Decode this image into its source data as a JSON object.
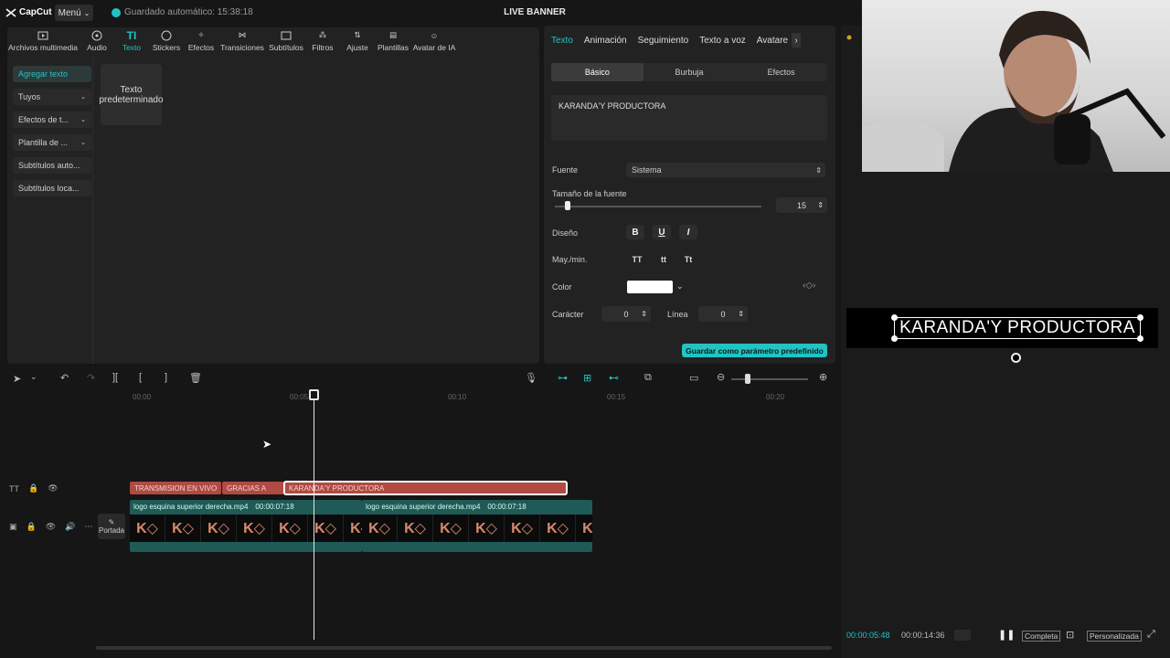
{
  "app": {
    "logo": "CapCut",
    "menu_label": "Menú",
    "autosave": "Guardado automático: 15:38:18",
    "project_title": "LIVE BANNER"
  },
  "toolbar": {
    "items": [
      {
        "label": "Archivos multimedia",
        "icon": "media-icon"
      },
      {
        "label": "Audio",
        "icon": "audio-icon"
      },
      {
        "label": "Texto",
        "icon": "text-icon"
      },
      {
        "label": "Stickers",
        "icon": "sticker-icon"
      },
      {
        "label": "Efectos",
        "icon": "effects-icon"
      },
      {
        "label": "Transiciones",
        "icon": "transitions-icon"
      },
      {
        "label": "Subtítulos",
        "icon": "subtitles-icon"
      },
      {
        "label": "Filtros",
        "icon": "filters-icon"
      },
      {
        "label": "Ajuste",
        "icon": "adjust-icon"
      },
      {
        "label": "Plantillas",
        "icon": "templates-icon"
      },
      {
        "label": "Avatar de IA",
        "icon": "avatar-icon"
      }
    ],
    "active_index": 2
  },
  "leftnav": {
    "items": [
      "Agregar texto",
      "Tuyos",
      "Efectos de t...",
      "Plantilla de ...",
      "Subtítulos auto...",
      "Subtítulos loca..."
    ]
  },
  "media_card": {
    "label": "Texto predeterminado"
  },
  "properties": {
    "tabs": [
      "Texto",
      "Animación",
      "Seguimiento",
      "Texto a voz",
      "Avatare"
    ],
    "subtabs": [
      "Básico",
      "Burbuja",
      "Efectos"
    ],
    "text_value": "KARANDA'Y PRODUCTORA",
    "font_label": "Fuente",
    "font_value": "Sistema",
    "size_label": "Tamaño de la fuente",
    "size_value": "15",
    "size_level": 0.05,
    "design_label": "Diseño",
    "bold": "B",
    "underline": "U",
    "italic": "I",
    "case_label": "May./min.",
    "case_upper": "TT",
    "case_lower": "tt",
    "case_title": "Tt",
    "color_label": "Color",
    "color_value": "#ffffff",
    "char_label": "Carácter",
    "char_value": "0",
    "line_label": "Línea",
    "line_value": "0",
    "save_preset": "Guardar como parámetro predefinido"
  },
  "preview": {
    "overlay_text": "KARANDA'Y PRODUCTORA",
    "current_time": "00:00:05:48",
    "total_time": "00:00:14:36",
    "complete_label": "Completa",
    "custom_label": "Personalizada"
  },
  "timeline": {
    "ruler": [
      "00:00",
      "00:05",
      "00:10",
      "00:15",
      "00:20"
    ],
    "text_clips": [
      "TRANSMISION EN VIVO",
      "GRACIAS A",
      "KARANDA'Y PRODUCTORA"
    ],
    "video_clips": [
      {
        "name": "logo esquina superior derecha.mp4",
        "duration": "00:00:07:18"
      },
      {
        "name": "logo esquina superior derecha.mp4",
        "duration": "00:00:07:18"
      }
    ],
    "cover_label": "Portada"
  },
  "colors": {
    "accent": "#22c3c3",
    "text_clip": "#b04a43",
    "video_clip": "#1f5a57"
  }
}
